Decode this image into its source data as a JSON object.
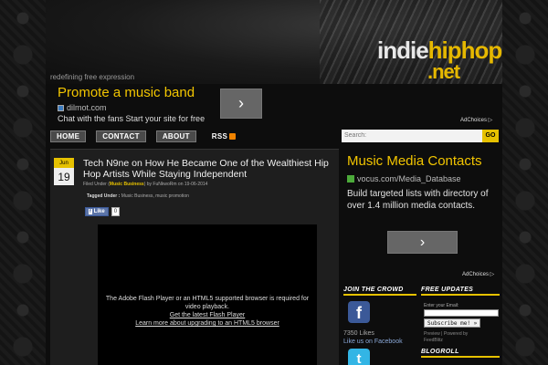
{
  "site": {
    "logo_part1": "indie",
    "logo_part2": "hiphop",
    "logo_part3": ".net",
    "tagline": "redefining free expression"
  },
  "top_ad": {
    "title": "Promote a music band",
    "url": "dilmot.com",
    "description": "Chat with the fans Start your site for free",
    "arrow": "›",
    "adchoices": "AdChoices ▷"
  },
  "nav": {
    "items": [
      "HOME",
      "CONTACT",
      "ABOUT"
    ],
    "rss_label": "RSS"
  },
  "search": {
    "placeholder": "Search:",
    "button": "GO"
  },
  "post": {
    "month": "Jun",
    "day": "19",
    "title": "Tech N9ne on How He Became One of the Wealthiest Hip Hop Artists While Staying Independent",
    "meta_prefix": "Filed Under (",
    "category": "Music Business",
    "meta_suffix": ") by FuNkwoRm on 19-06-2014",
    "tags_label": "Tagged Under :",
    "tags": "Music Business, music promotion",
    "like_label": "Like",
    "like_count": "0",
    "video_msg": "The Adobe Flash Player or an HTML5 supported browser is required for video playback.",
    "video_link1": "Get the latest Flash Player",
    "video_link2": "Learn more about upgrading to an HTML5 browser"
  },
  "side_ad": {
    "title": "Music Media Contacts",
    "url": "vocus.com/Media_Database",
    "description": "Build targeted lists with directory of over 1.4 million media contacts.",
    "arrow": "›",
    "adchoices": "AdChoices ▷"
  },
  "widgets": {
    "join_title": "JOIN THE CROWD",
    "likes_count": "7350 Likes",
    "likes_link": "Like us on Facebook",
    "updates_title": "FREE UPDATES",
    "email_label": "Enter your Email:",
    "subscribe_label": "Subscribe me! »",
    "feed_preview": "Preview | Powered by",
    "feed_burner": "FeedBlitz",
    "blogroll_title": "BLOGROLL"
  }
}
